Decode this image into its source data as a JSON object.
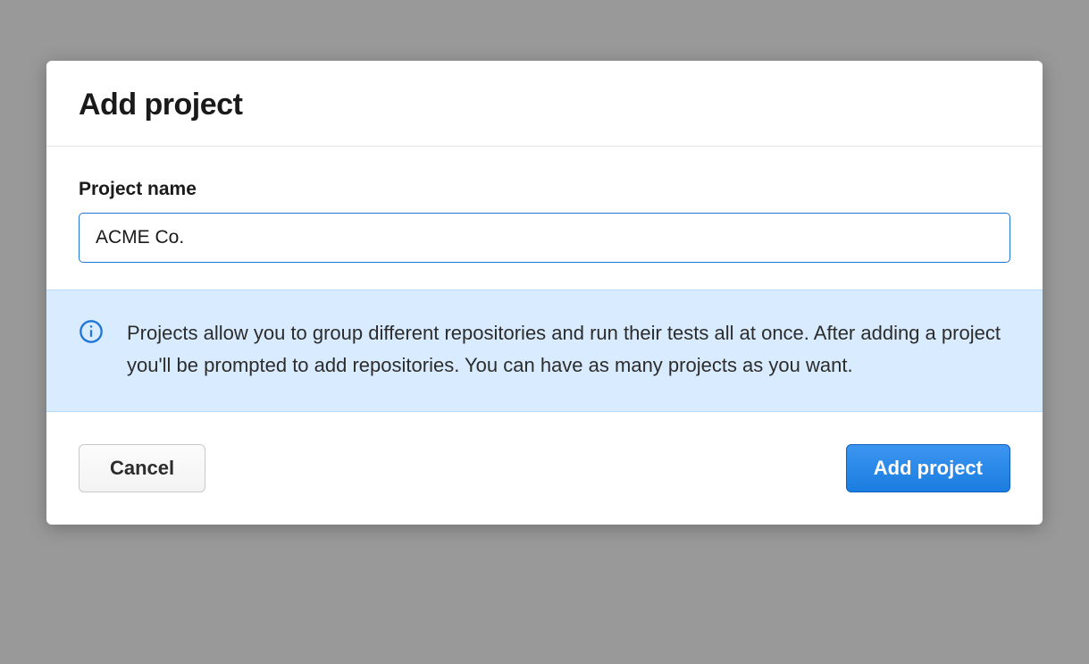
{
  "dialog": {
    "title": "Add project",
    "field": {
      "label": "Project name",
      "value": "ACME Co."
    },
    "info": {
      "text": "Projects allow you to group different repositories and run their tests all at once. After adding a project you'll be prompted to add repositories. You can have as many projects as you want."
    },
    "footer": {
      "cancel_label": "Cancel",
      "submit_label": "Add project"
    }
  }
}
